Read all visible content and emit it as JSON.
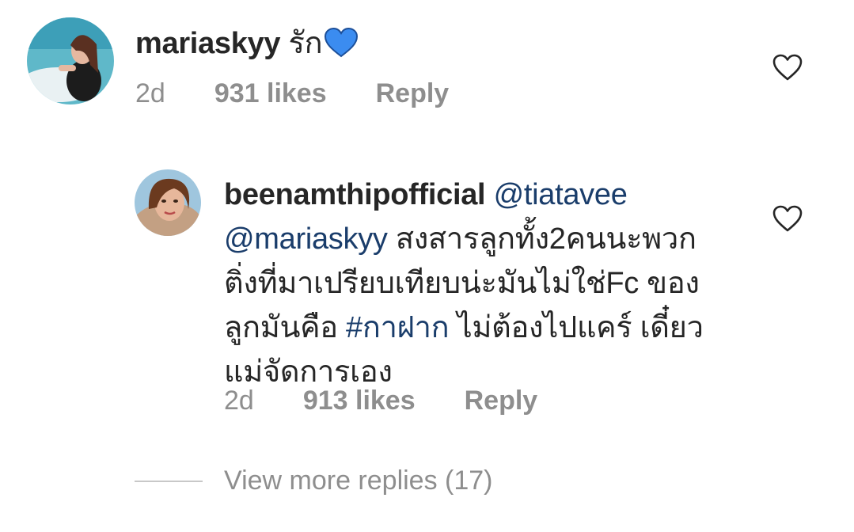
{
  "comments": [
    {
      "username": "mariaskyy",
      "text": "รัก",
      "emoji": "blue-heart-emoji",
      "time": "2d",
      "likes": "931 likes",
      "reply_label": "Reply"
    },
    {
      "username": "beenamthipofficial",
      "mention_1": "@tiatavee",
      "mention_2": "@mariaskyy",
      "text_part_1": "สงสารลูกทั้ง2คนนะพวก",
      "text_part_2": "ติ่งที่มาเปรียบเทียบน่ะมันไม่ใช่Fc ของ",
      "text_part_3": "ลูกมันคือ",
      "hashtag": "#กาฝาก",
      "text_part_4": "ไม่ต้องไปแคร์ เดี๋ยว",
      "text_part_5": "แม่จัดการเอง",
      "time": "2d",
      "likes": "913 likes",
      "reply_label": "Reply"
    }
  ],
  "view_more_replies": "View more replies (17)",
  "colors": {
    "text": "#262626",
    "meta": "#8e8e8e",
    "link": "#1a3d6b",
    "emoji_heart": "#3b8cf0"
  },
  "icons": {
    "like": "heart-outline-icon"
  }
}
